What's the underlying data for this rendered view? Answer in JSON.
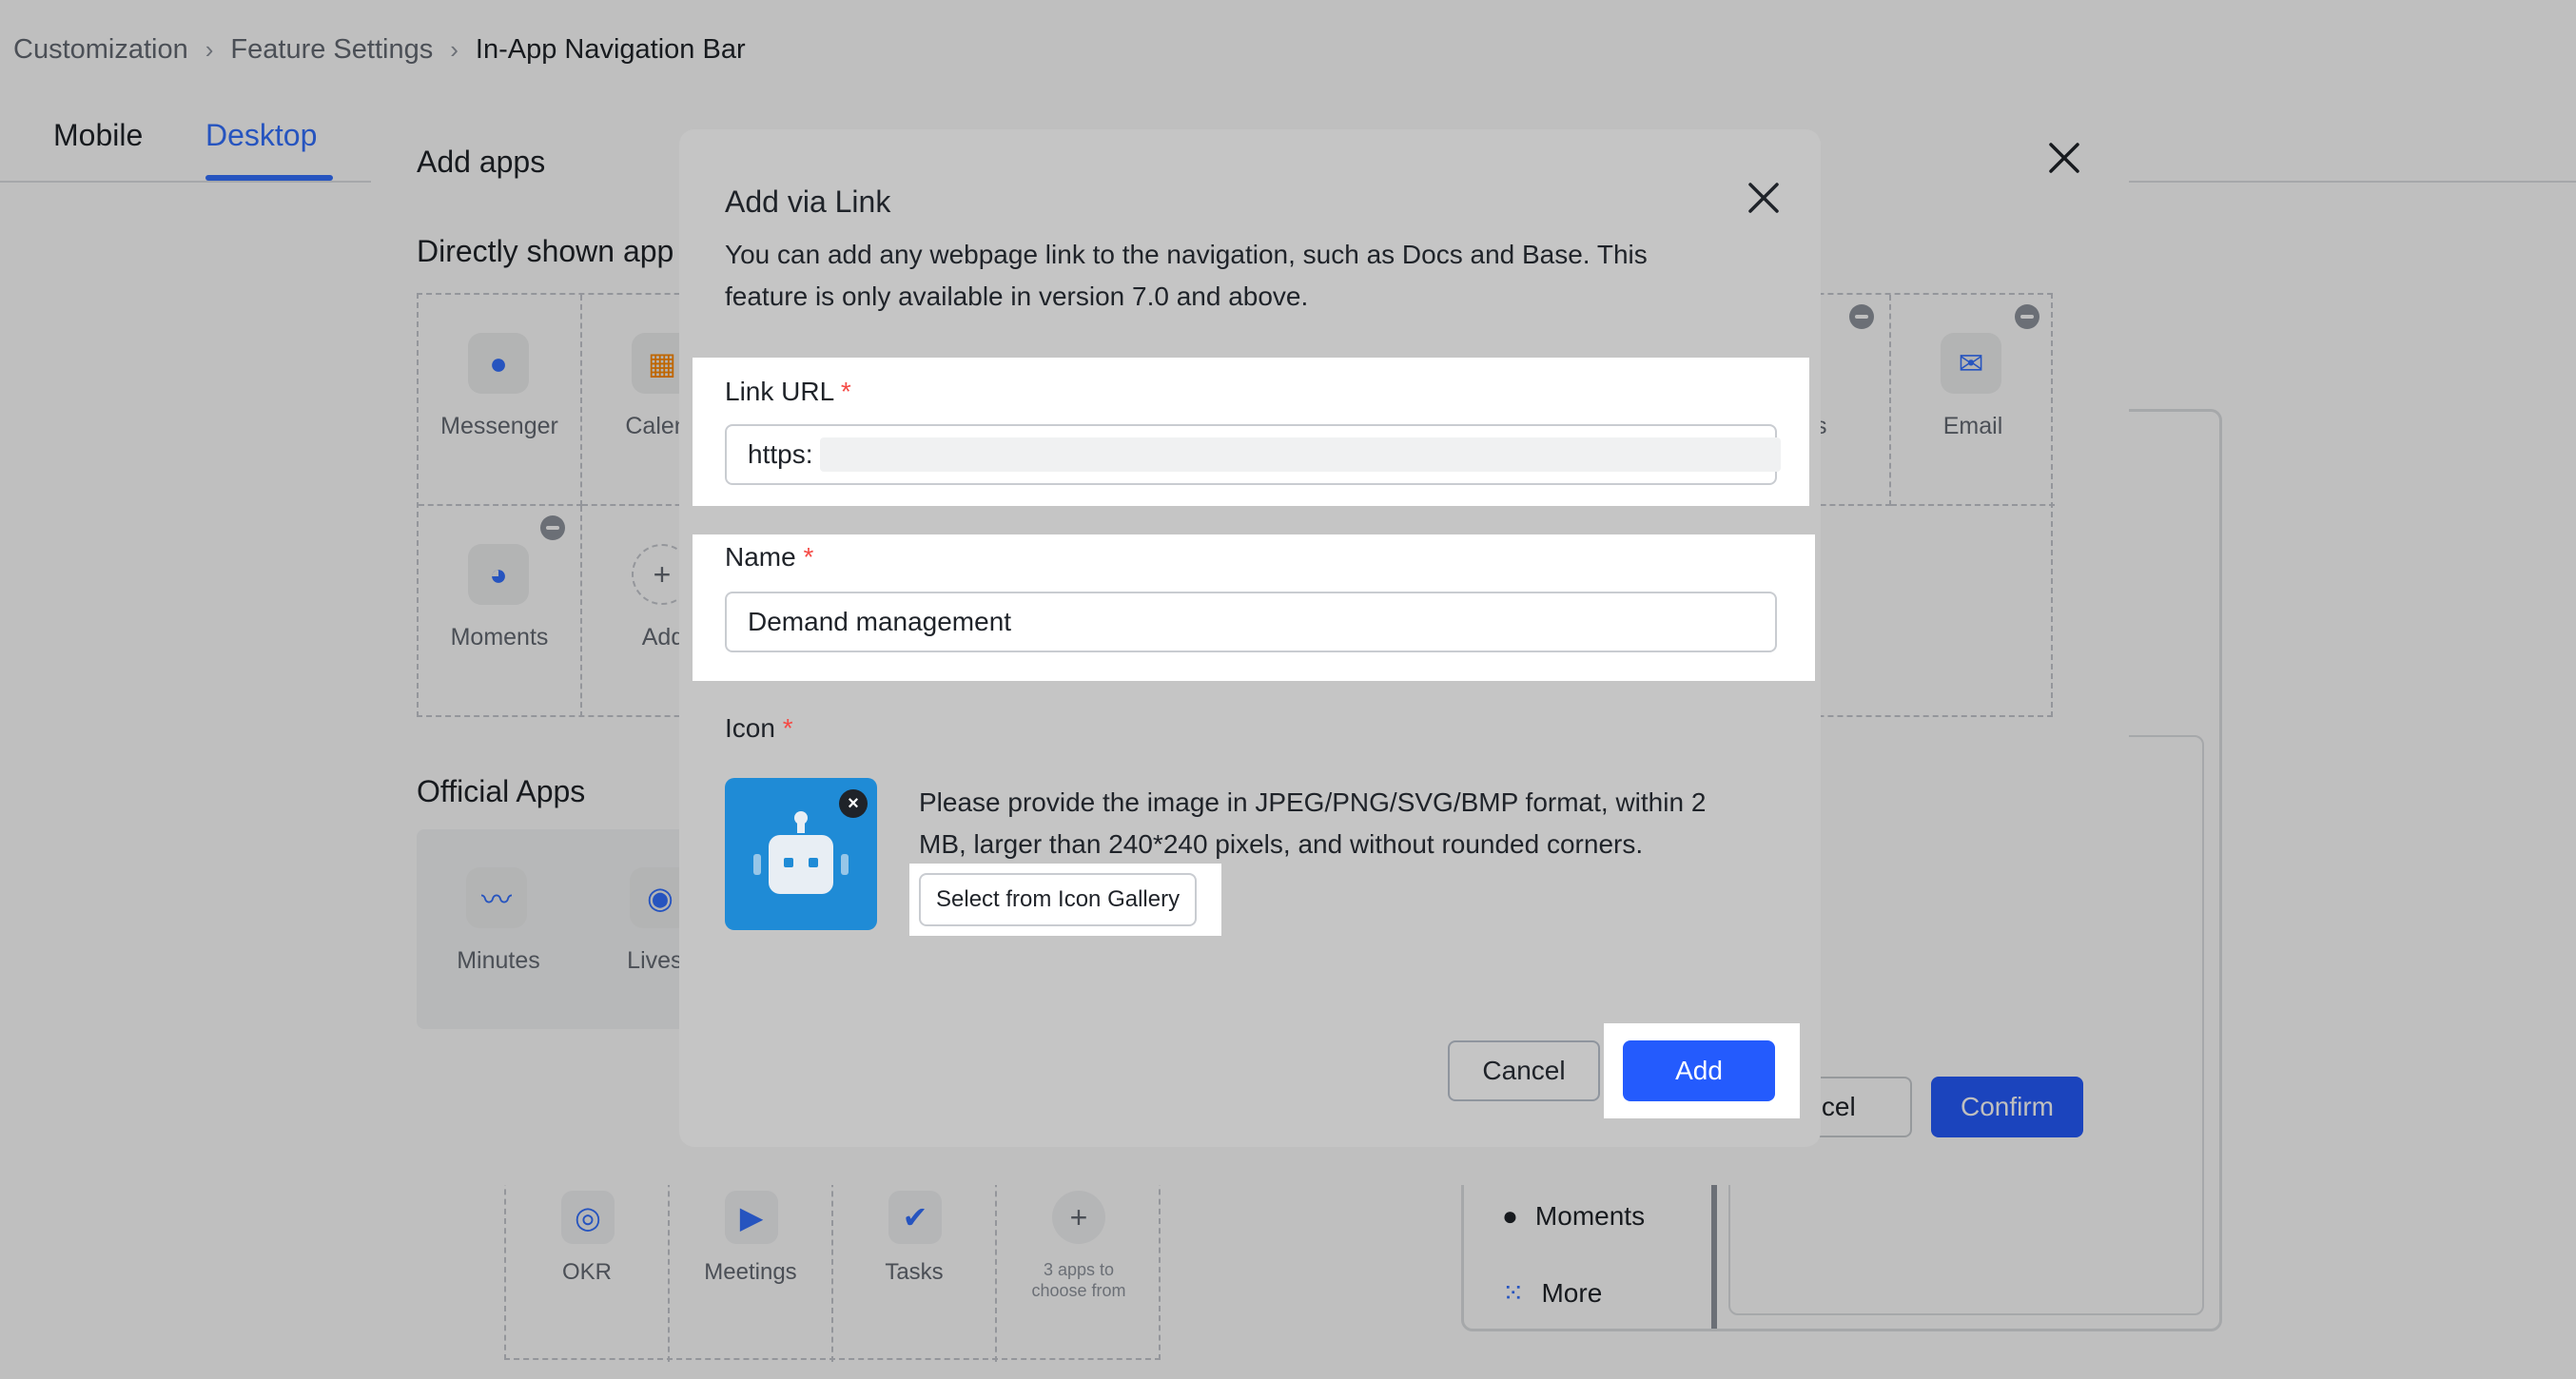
{
  "breadcrumb": {
    "items": [
      "Customization",
      "Feature Settings",
      "In-App Navigation Bar"
    ]
  },
  "tabs": {
    "mobile": "Mobile",
    "desktop": "Desktop"
  },
  "add_apps_modal": {
    "title": "Add apps",
    "directly_shown_heading": "Directly shown app",
    "official_apps_heading": "Official Apps",
    "apps": {
      "messenger": "Messenger",
      "calendar": "Calend",
      "favorites": "ites",
      "email": "Email",
      "moments": "Moments",
      "add": "Add",
      "minutes": "Minutes",
      "livestream": "Livestr"
    },
    "cancel_label": "ncel",
    "confirm_label": "Confirm"
  },
  "bottom_grid": {
    "okr": "OKR",
    "meetings": "Meetings",
    "tasks": "Tasks",
    "more_apps": "3 apps to choose from"
  },
  "preview": {
    "moments": "Moments",
    "more": "More",
    "side_label": "ts"
  },
  "dialog": {
    "title": "Add via Link",
    "description": "You can add any webpage link to the navigation, such as Docs and Base. This feature is only available in version 7.0 and above.",
    "link_url": {
      "label": "Link URL",
      "value": "https:"
    },
    "name": {
      "label": "Name",
      "value": "Demand management"
    },
    "icon": {
      "label": "Icon",
      "hint": "Please provide the image in JPEG/PNG/SVG/BMP format, within 2 MB, larger than 240*240 pixels, and without rounded corners.",
      "gallery_button": "Select from Icon Gallery"
    },
    "required_mark": "*",
    "cancel_label": "Cancel",
    "add_label": "Add"
  },
  "colors": {
    "accent": "#3370ff",
    "primary_button": "#245bfd",
    "required": "#f54a45",
    "icon_tile": "#1f8bd6"
  }
}
